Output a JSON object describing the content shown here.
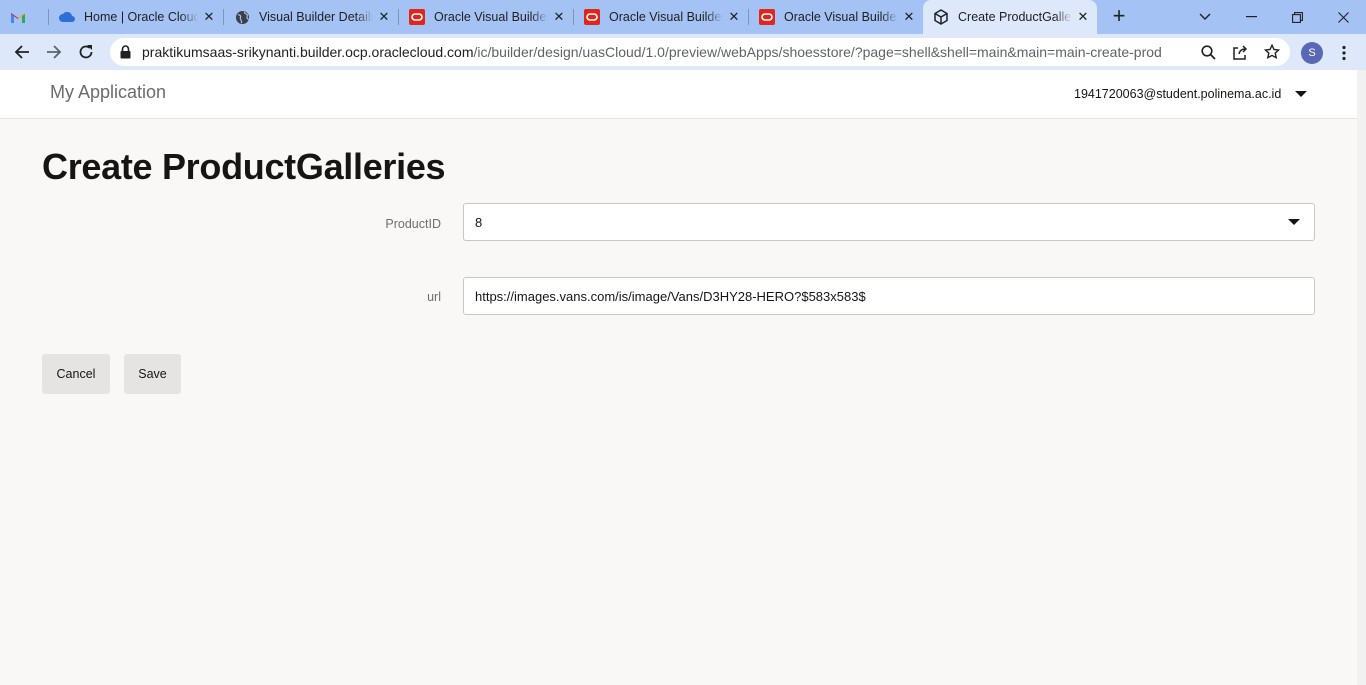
{
  "browser": {
    "tabs": [
      {
        "title": "",
        "icon": "gmail-icon"
      },
      {
        "title": "Home | Oracle Cloud",
        "icon": "oracle-cloud-icon"
      },
      {
        "title": "Visual Builder Details",
        "icon": "globe-icon"
      },
      {
        "title": "Oracle Visual Builder",
        "icon": "oracle-icon"
      },
      {
        "title": "Oracle Visual Builder",
        "icon": "oracle-icon"
      },
      {
        "title": "Oracle Visual Builder",
        "icon": "oracle-icon"
      },
      {
        "title": "Create ProductGalleries",
        "icon": "cube-icon"
      }
    ],
    "new_tab_symbol": "+",
    "url_host": "praktikumsaas-srikynanti.builder.ocp.oraclecloud.com",
    "url_path": "/ic/builder/design/uasCloud/1.0/preview/webApps/shoesstore/?page=shell&shell=main&main=main-create-prod...",
    "profile_initial": "S",
    "accent_color": "#a4c2f4",
    "active_tab_color": "#dde8fb"
  },
  "app": {
    "title": "My Application",
    "user": "1941720063@student.polinema.ac.id"
  },
  "page": {
    "title": "Create ProductGalleries",
    "form": {
      "product_id_label": "ProductID",
      "product_id_value": "8",
      "url_label": "url",
      "url_value": "https://images.vans.com/is/image/Vans/D3HY28-HERO?$583x583$"
    },
    "buttons": {
      "cancel": "Cancel",
      "save": "Save"
    }
  }
}
